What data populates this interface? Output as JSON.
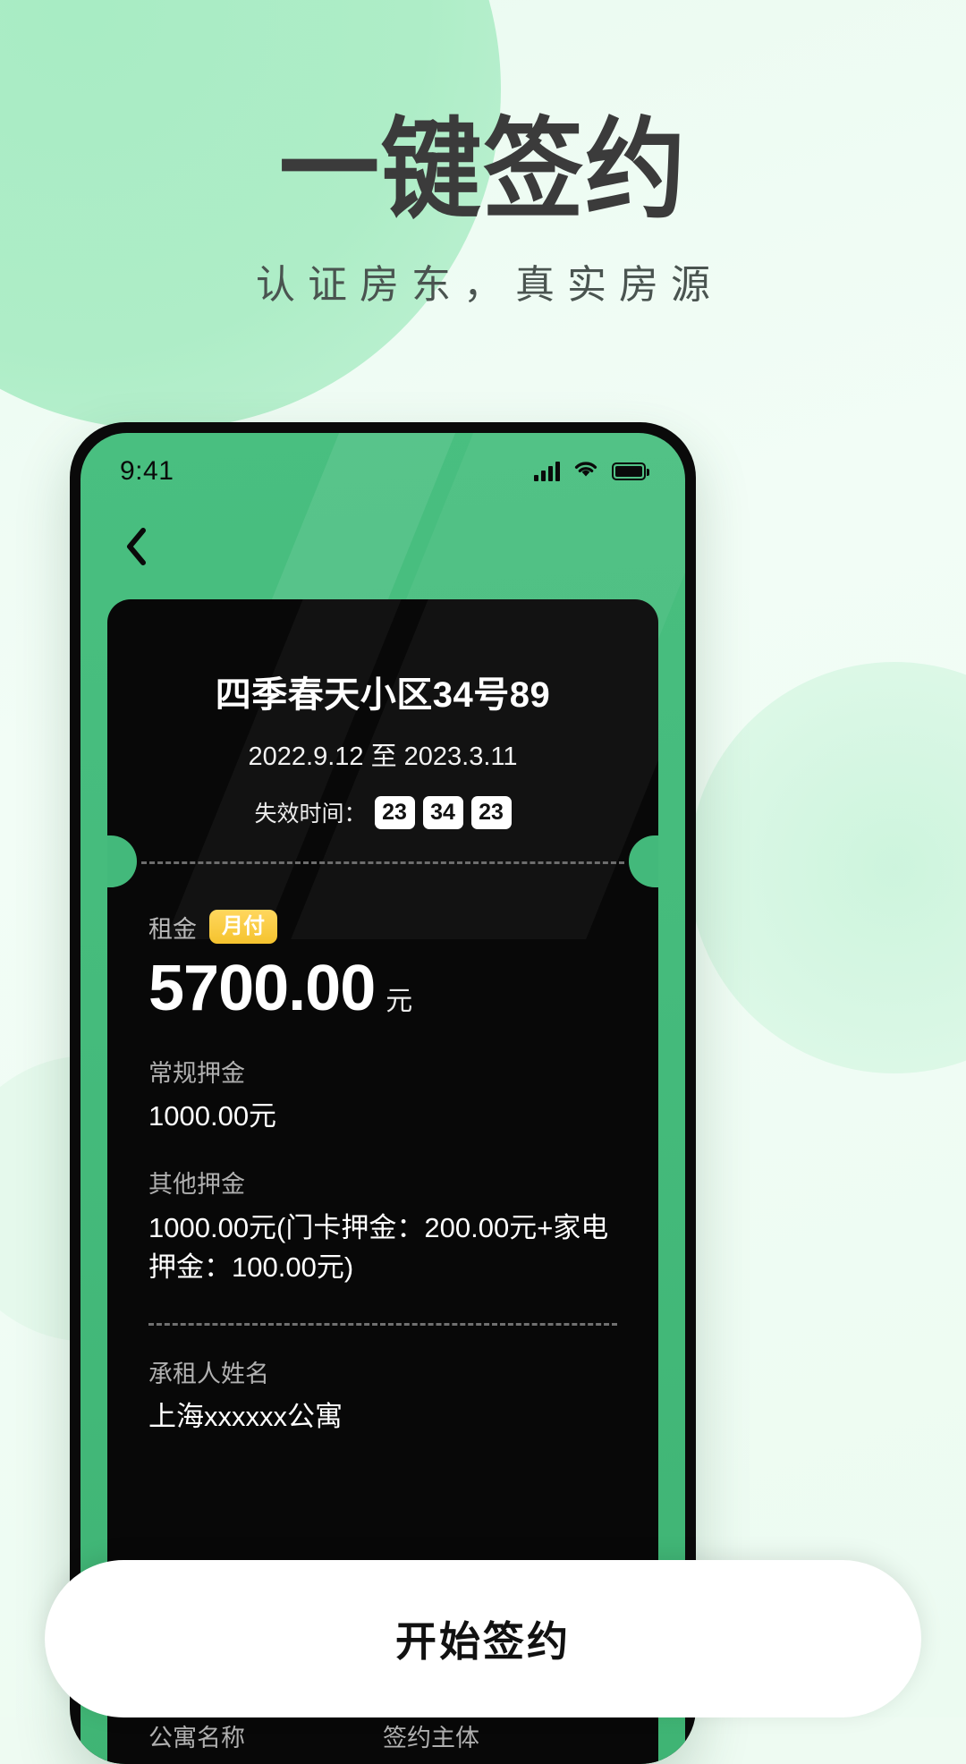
{
  "poster": {
    "title": "一键签约",
    "subtitle": "认证房东，真实房源",
    "accent_green": "#43b97b",
    "bg_light": "#eefbf2"
  },
  "phone": {
    "status_bar": {
      "time": "9:41",
      "signal_icon": "cellular-bars-icon",
      "wifi_icon": "wifi-icon",
      "battery_icon": "battery-full-icon"
    },
    "nav": {
      "back_icon": "chevron-left-icon"
    },
    "ticket": {
      "address": "四季春天小区34号89",
      "period": "2022.9.12 至 2023.3.11",
      "expire_label": "失效时间：",
      "countdown": [
        "23",
        "34",
        "23"
      ],
      "rent": {
        "label": "租金",
        "badge": "月付",
        "amount": "5700.00",
        "unit": "元",
        "badge_color": "#f5c32e"
      },
      "fields": [
        {
          "key": "常规押金",
          "value": "1000.00元"
        },
        {
          "key": "其他押金",
          "value": "1000.00元(门卡押金：200.00元+家电押金：100.00元)"
        },
        {
          "key": "承租人姓名",
          "value": "上海xxxxxx公寓"
        }
      ],
      "bottom_row": [
        {
          "key": "公寓名称"
        },
        {
          "key": "签约主体"
        }
      ]
    },
    "cta": {
      "label": "开始签约"
    }
  }
}
